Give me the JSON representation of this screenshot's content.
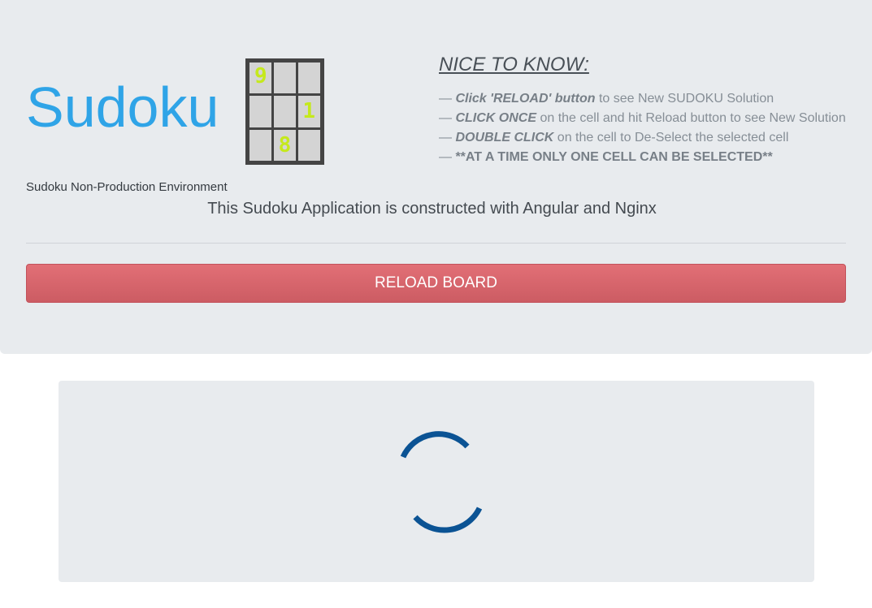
{
  "header": {
    "title": "Sudoku",
    "logo_digits": [
      "9",
      "",
      "",
      "",
      "",
      "1",
      "",
      "8",
      ""
    ],
    "logo_digit_color": "#c5e91c",
    "environment": "Sudoku Non-Production Environment",
    "description": "This Sudoku Application is constructed with Angular and Nginx"
  },
  "nice_to_know": {
    "heading": "NICE TO KNOW:",
    "items": [
      {
        "dash": "— ",
        "bold": "Click 'RELOAD' button",
        "rest": " to see New SUDOKU Solution"
      },
      {
        "dash": "— ",
        "bold": "CLICK ONCE",
        "rest": " on the cell and hit Reload button to see New Solution"
      },
      {
        "dash": "— ",
        "bold": "DOUBLE CLICK",
        "rest": " on the cell to De-Select the selected cell"
      },
      {
        "dash": "— ",
        "bold": "**AT A TIME ONLY ONE CELL CAN BE SELECTED**",
        "rest": ""
      }
    ]
  },
  "reload_button": {
    "label": "RELOAD BOARD",
    "color": "#d9534f"
  },
  "board": {
    "state": "loading",
    "spinner_icon": "loading-spinner-icon",
    "spinner_color": "#0b5394"
  },
  "colors": {
    "brand": "#2fa4e7",
    "panel_background": "#e8ebee"
  }
}
